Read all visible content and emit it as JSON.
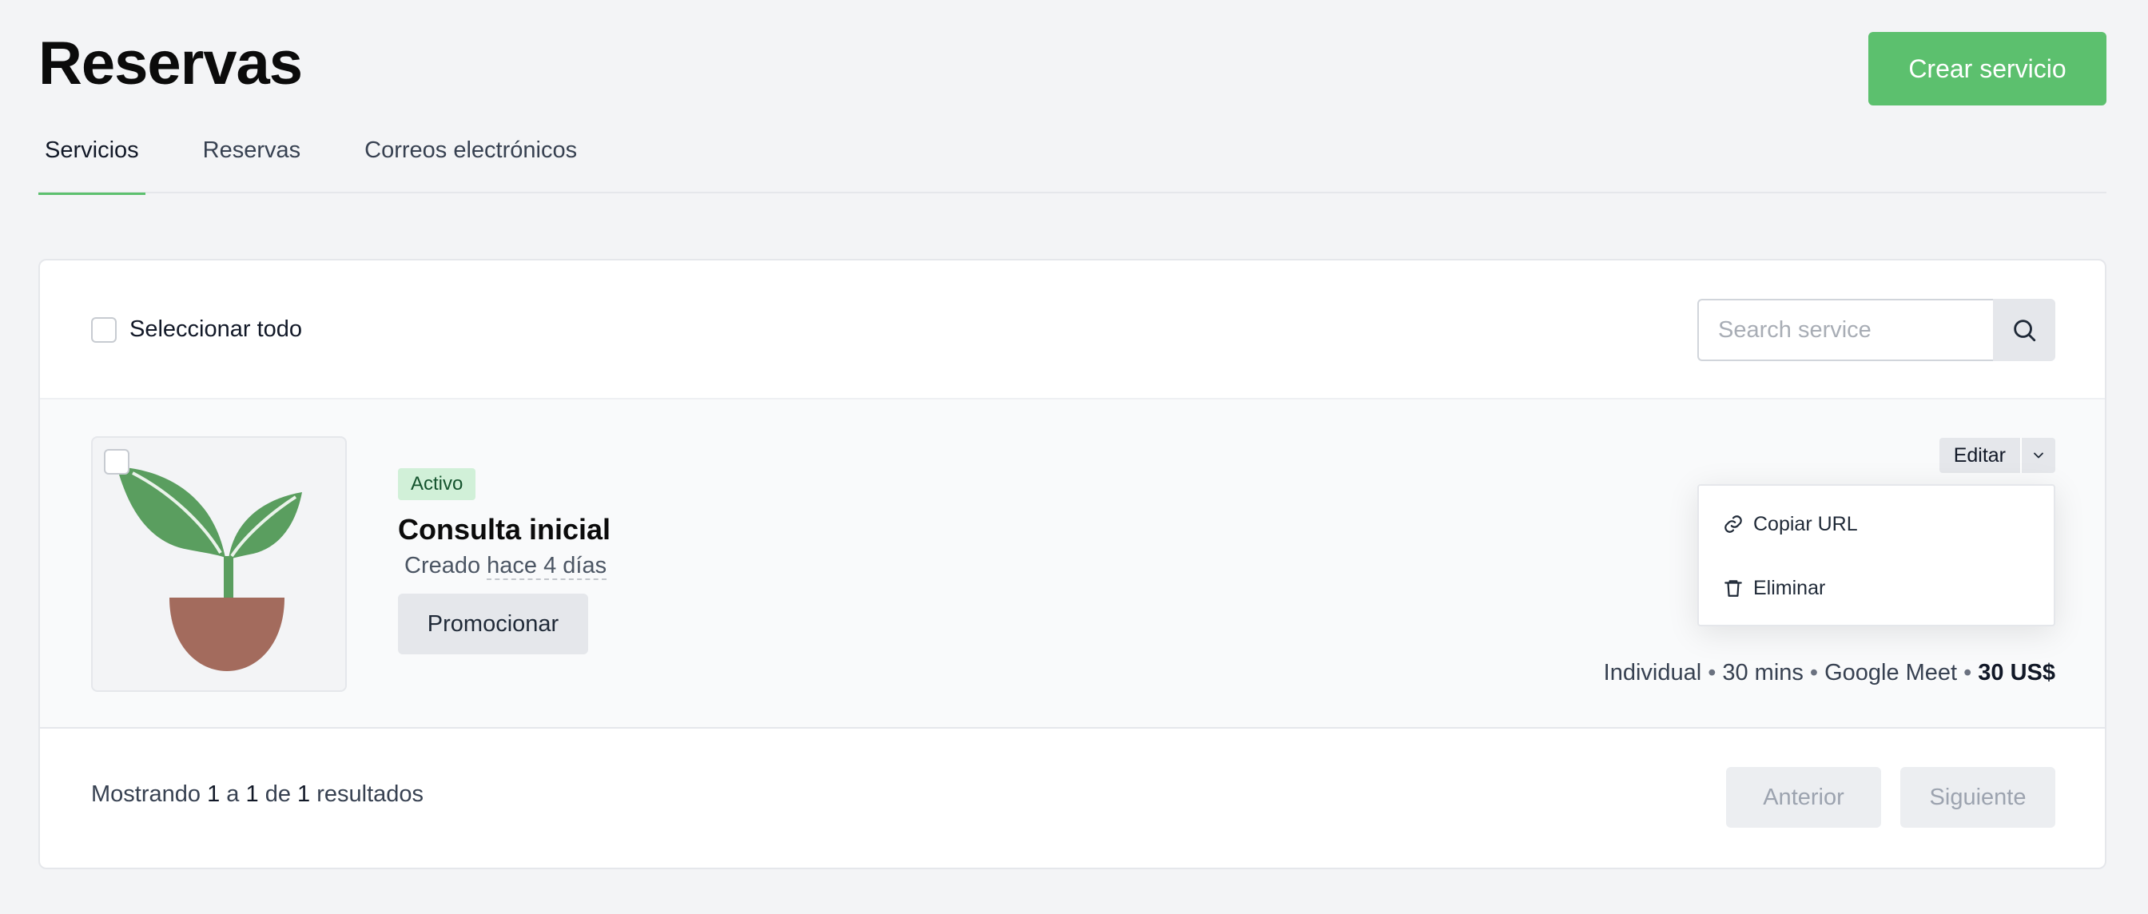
{
  "header": {
    "title": "Reservas",
    "create_button": "Crear servicio"
  },
  "tabs": [
    {
      "label": "Servicios",
      "active": true
    },
    {
      "label": "Reservas",
      "active": false
    },
    {
      "label": "Correos electrónicos",
      "active": false
    }
  ],
  "toolbar": {
    "select_all_label": "Seleccionar todo",
    "search_placeholder": "Search service",
    "search_value": ""
  },
  "service": {
    "status_badge": "Activo",
    "title": "Consulta inicial",
    "created_prefix": "Creado",
    "created_relative": "hace 4 días",
    "promote_button": "Promocionar",
    "edit_button": "Editar",
    "menu": [
      {
        "label": "Copiar URL",
        "icon": "link-icon"
      },
      {
        "label": "Eliminar",
        "icon": "trash-icon"
      }
    ],
    "meta": {
      "type": "Individual",
      "duration": "30 mins",
      "location": "Google Meet",
      "price": "30 US$",
      "separator": "•"
    }
  },
  "footer": {
    "showing": "Mostrando",
    "from": "1",
    "to_word": "a",
    "to": "1",
    "of_word": "de",
    "total": "1",
    "results_word": "resultados",
    "prev_button": "Anterior",
    "next_button": "Siguiente"
  },
  "colors": {
    "accent": "#5cc06e",
    "badge_bg": "#d1f0d8",
    "plant_green": "#5a9e5f",
    "pot": "#a36b5d"
  }
}
